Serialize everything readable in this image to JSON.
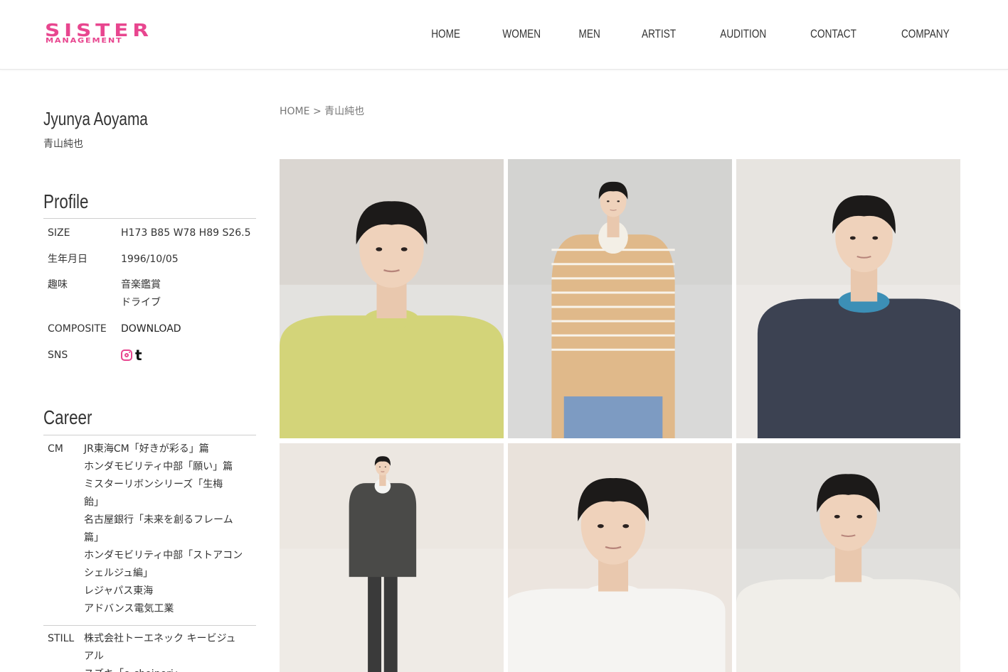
{
  "brand": {
    "line1": "SISTER",
    "line2": "MANAGEMENT",
    "color": "#e8468f"
  },
  "nav": [
    "HOME",
    "WOMEN",
    "MEN",
    "ARTIST",
    "AUDITION",
    "CONTACT",
    "COMPANY"
  ],
  "breadcrumb": {
    "home": "HOME",
    "sep": ">",
    "current": "青山純也"
  },
  "person": {
    "name_en": "Jyunya Aoyama",
    "name_jp": "青山純也"
  },
  "profile": {
    "title": "Profile",
    "size_label": "SIZE",
    "size_value": "H173 B85 W78 H89 S26.5",
    "birth_label": "生年月日",
    "birth_value": "1996/10/05",
    "hobby_label": "趣味",
    "hobbies": [
      "音楽鑑賞",
      "ドライブ"
    ],
    "composite_label": "COMPOSITE",
    "composite_value": "DOWNLOAD",
    "sns_label": "SNS",
    "sns_icons": [
      "instagram-icon",
      "tumblr-icon"
    ],
    "tumblr_glyph": "t"
  },
  "career": {
    "title": "Career",
    "cm_label": "CM",
    "cm_lines": [
      "JR東海CM「好きが彩る」篇",
      "ホンダモビリティ中部「願い」篇",
      "ミスターリボンシリーズ「生梅",
      "飴」",
      "名古屋銀行「未来を創るフレーム",
      "篇」",
      "ホンダモビリティ中部「ストアコン",
      "シェルジュ編」",
      "レジャパス東海",
      "アドバンス電気工業"
    ],
    "still_label": "STILL",
    "still_lines": [
      "株式会社トーエネック キービジュ",
      "アル",
      "スズキ「e-choinori」"
    ]
  },
  "photos": [
    {
      "alt": "headshot-yellow-sweater",
      "bg": "#e3e2df",
      "top": "#d4cfc8",
      "cloth": "#d3d479",
      "inner": "#d3d479"
    },
    {
      "alt": "standing-striped-sweater",
      "bg": "#d9d9d8",
      "top": "#cfcfcd",
      "cloth": "#e0b98a",
      "inner": "#f3efe6"
    },
    {
      "alt": "seated-navy-jacket",
      "bg": "#ece9e6",
      "top": "#e5e1dc",
      "cloth": "#3c4252",
      "inner": "#3c8fb6"
    },
    {
      "alt": "full-body-cardigan",
      "bg": "#efebe6",
      "top": "#e9e4de",
      "cloth": "#4a4a48",
      "inner": "#f4f4f2"
    },
    {
      "alt": "headshot-white-tee",
      "bg": "#ece5df",
      "top": "#e8e0d9",
      "cloth": "#f5f4f2",
      "inner": "#f5f4f2"
    },
    {
      "alt": "headshot-white-sweatshirt",
      "bg": "#e1e0dd",
      "top": "#d8d6d3",
      "cloth": "#f0eee9",
      "inner": "#f0eee9"
    }
  ]
}
